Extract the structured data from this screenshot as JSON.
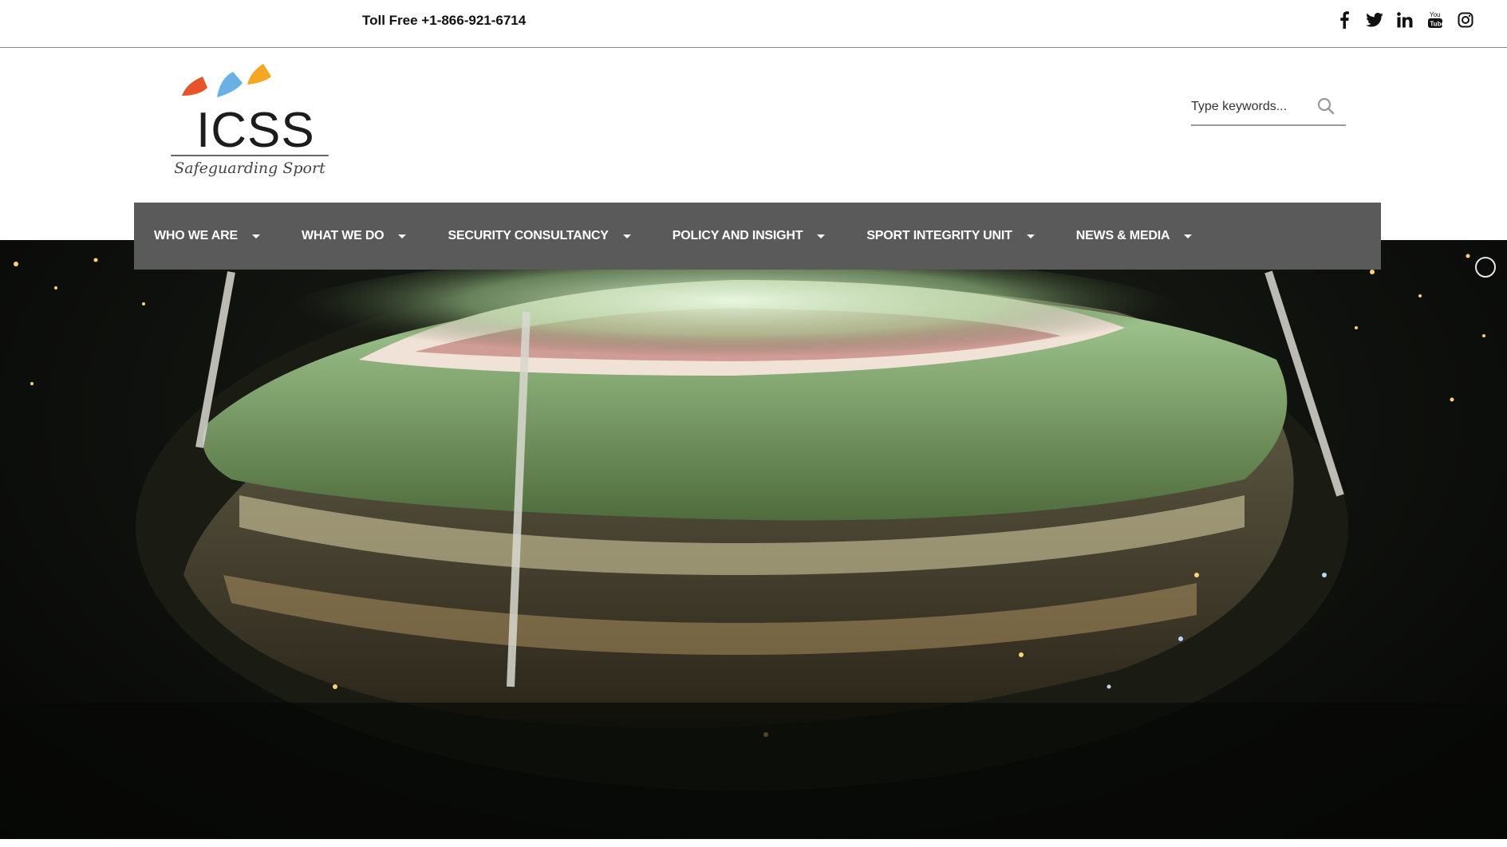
{
  "topbar": {
    "toll_free": "Toll Free +1-866-921-6714",
    "social": [
      "facebook-icon",
      "twitter-icon",
      "linkedin-icon",
      "youtube-icon",
      "instagram-icon"
    ]
  },
  "logo": {
    "name": "ICSS",
    "tagline": "Safeguarding Sport",
    "colors": [
      "#e8542a",
      "#6ab0e4",
      "#f5a623"
    ]
  },
  "search": {
    "placeholder": "Type keywords..."
  },
  "nav": {
    "items": [
      {
        "label": "WHO WE ARE"
      },
      {
        "label": "WHAT WE DO"
      },
      {
        "label": "SECURITY CONSULTANCY"
      },
      {
        "label": "POLICY AND INSIGHT"
      },
      {
        "label": "SPORT INTEGRITY UNIT"
      },
      {
        "label": "NEWS & MEDIA"
      }
    ],
    "background": "#5a5a5a"
  },
  "hero": {
    "image": "night-aerial-stadium"
  }
}
